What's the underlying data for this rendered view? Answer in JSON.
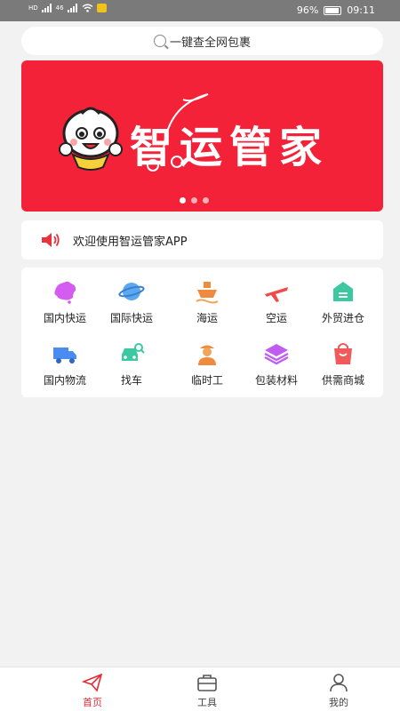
{
  "statusbar": {
    "battery": "96%",
    "time": "09:11",
    "net_left": "HD",
    "net_right": "46"
  },
  "search": {
    "placeholder": "一键查全网包裹"
  },
  "banner": {
    "title": "智运管家",
    "slides": 3,
    "active_slide": 1
  },
  "notice": {
    "text": "欢迎使用智运管家APP"
  },
  "services": [
    {
      "label": "国内快运",
      "icon": "china-map-icon",
      "color": "#d45cf0"
    },
    {
      "label": "国际快运",
      "icon": "planet-icon",
      "color": "#5aa8f0"
    },
    {
      "label": "海运",
      "icon": "ship-icon",
      "color": "#f08a3c"
    },
    {
      "label": "空运",
      "icon": "airplane-icon",
      "color": "#f04a4a"
    },
    {
      "label": "外贸进仓",
      "icon": "warehouse-icon",
      "color": "#3cc8a0"
    },
    {
      "label": "国内物流",
      "icon": "truck-icon",
      "color": "#4a8cf0"
    },
    {
      "label": "找车",
      "icon": "car-search-icon",
      "color": "#3cc8a0"
    },
    {
      "label": "临时工",
      "icon": "worker-icon",
      "color": "#f08a3c"
    },
    {
      "label": "包装材料",
      "icon": "layers-icon",
      "color": "#c05cf0"
    },
    {
      "label": "供需商城",
      "icon": "shopping-bag-icon",
      "color": "#f05a5a"
    }
  ],
  "tabs": [
    {
      "label": "首页",
      "icon": "paper-plane-icon",
      "active": true
    },
    {
      "label": "工具",
      "icon": "briefcase-icon",
      "active": false
    },
    {
      "label": "我的",
      "icon": "user-icon",
      "active": false
    }
  ]
}
